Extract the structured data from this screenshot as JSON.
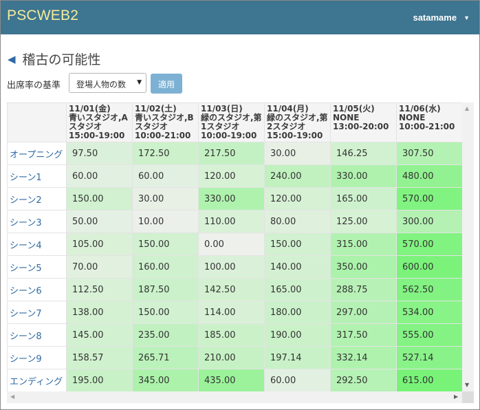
{
  "navbar": {
    "brand": "PSCWEB2",
    "user": "satamame",
    "user_caret": "▼"
  },
  "page": {
    "back_icon": "◀",
    "title": "稽古の可能性"
  },
  "controls": {
    "criteria_label": "出席率の基準",
    "criteria_value": "登場人物の数",
    "criteria_caret": "▼",
    "apply_label": "適用"
  },
  "table": {
    "columns": [
      {
        "date": "11/01(金)",
        "place": "青いスタジオ,Aスタジオ",
        "time": "15:00-19:00"
      },
      {
        "date": "11/02(土)",
        "place": "青いスタジオ,Bスタジオ",
        "time": "10:00-21:00"
      },
      {
        "date": "11/03(日)",
        "place": "緑のスタジオ,第1スタジオ",
        "time": "10:00-19:00"
      },
      {
        "date": "11/04(月)",
        "place": "緑のスタジオ,第2スタジオ",
        "time": "15:00-19:00"
      },
      {
        "date": "11/05(火)",
        "place": "NONE",
        "time": "13:00-20:00"
      },
      {
        "date": "11/06(水)",
        "place": "NONE",
        "time": "10:00-21:00"
      }
    ],
    "rows": [
      {
        "name": "オープニング",
        "values": [
          "97.50",
          "172.50",
          "217.50",
          "30.00",
          "146.25",
          "307.50"
        ]
      },
      {
        "name": "シーン1",
        "values": [
          "60.00",
          "60.00",
          "120.00",
          "240.00",
          "330.00",
          "480.00"
        ]
      },
      {
        "name": "シーン2",
        "values": [
          "150.00",
          "30.00",
          "330.00",
          "120.00",
          "165.00",
          "570.00"
        ]
      },
      {
        "name": "シーン3",
        "values": [
          "50.00",
          "10.00",
          "110.00",
          "80.00",
          "125.00",
          "300.00"
        ]
      },
      {
        "name": "シーン4",
        "values": [
          "105.00",
          "150.00",
          "0.00",
          "150.00",
          "315.00",
          "570.00"
        ]
      },
      {
        "name": "シーン5",
        "values": [
          "70.00",
          "160.00",
          "100.00",
          "140.00",
          "350.00",
          "600.00"
        ]
      },
      {
        "name": "シーン6",
        "values": [
          "112.50",
          "187.50",
          "142.50",
          "165.00",
          "288.75",
          "562.50"
        ]
      },
      {
        "name": "シーン7",
        "values": [
          "138.00",
          "150.00",
          "114.00",
          "180.00",
          "297.00",
          "534.00"
        ]
      },
      {
        "name": "シーン8",
        "values": [
          "145.00",
          "235.00",
          "185.00",
          "190.00",
          "317.50",
          "555.00"
        ]
      },
      {
        "name": "シーン9",
        "values": [
          "158.57",
          "265.71",
          "210.00",
          "197.14",
          "332.14",
          "527.14"
        ]
      },
      {
        "name": "エンディング",
        "values": [
          "195.00",
          "345.00",
          "435.00",
          "60.00",
          "292.50",
          "615.00"
        ]
      }
    ]
  },
  "scrollbar_icons": {
    "up": "▲",
    "down": "▼",
    "left": "◀",
    "right": "▶"
  }
}
